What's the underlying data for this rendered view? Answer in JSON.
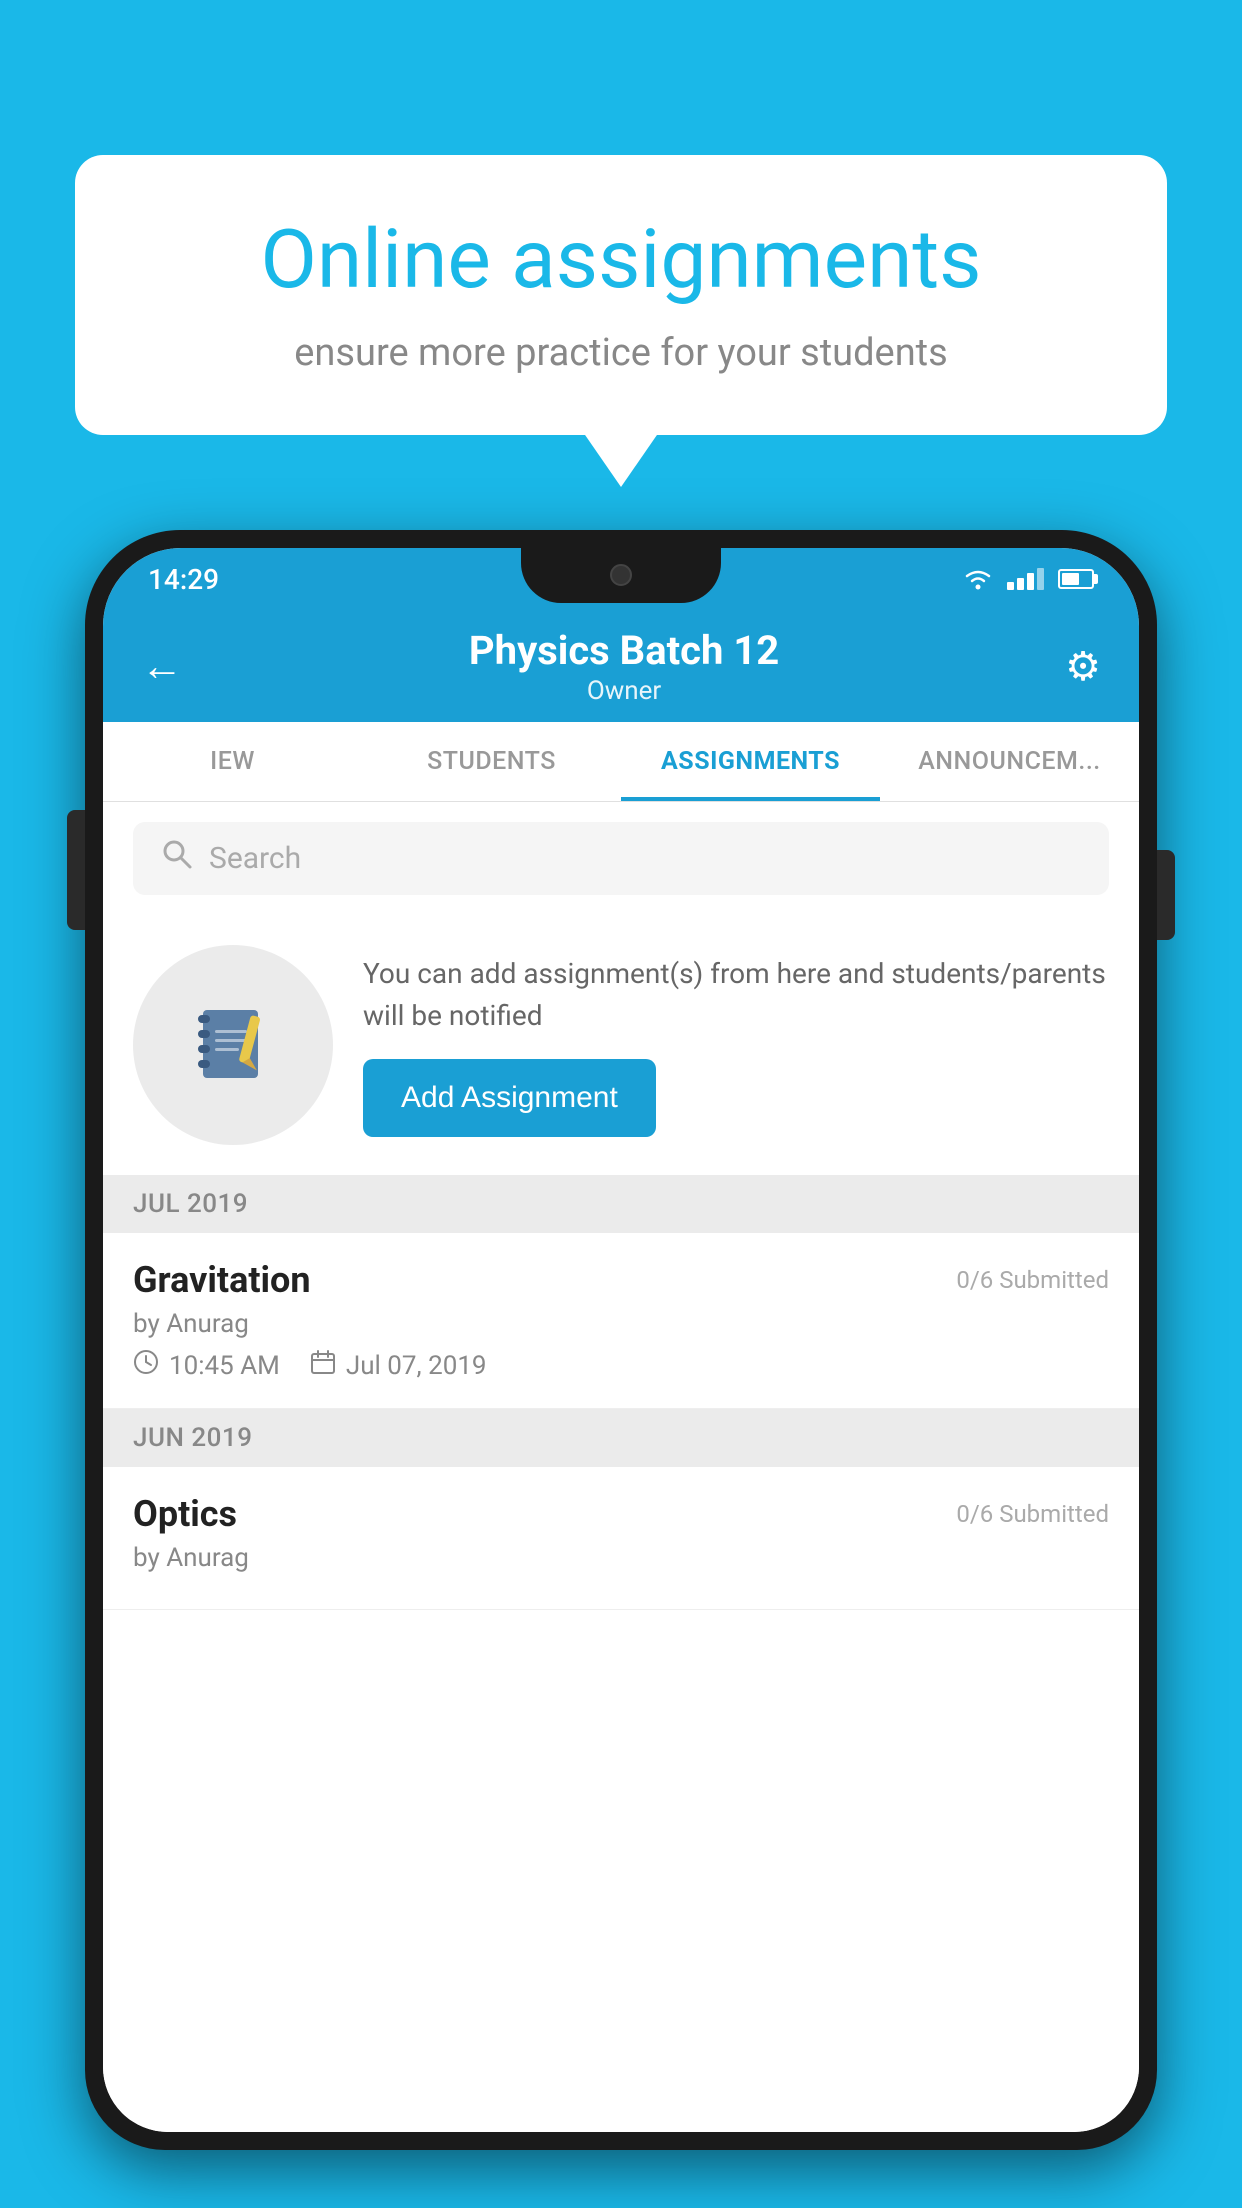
{
  "background_color": "#1ab8e8",
  "speech_bubble": {
    "title": "Online assignments",
    "subtitle": "ensure more practice for your students"
  },
  "status_bar": {
    "time": "14:29",
    "wifi": true,
    "signal": true,
    "battery": true
  },
  "header": {
    "title": "Physics Batch 12",
    "subtitle": "Owner",
    "back_label": "←",
    "settings_label": "⚙"
  },
  "tabs": [
    {
      "label": "IEW",
      "active": false
    },
    {
      "label": "STUDENTS",
      "active": false
    },
    {
      "label": "ASSIGNMENTS",
      "active": true
    },
    {
      "label": "ANNOUNCEM...",
      "active": false
    }
  ],
  "search": {
    "placeholder": "Search"
  },
  "promo": {
    "text": "You can add assignment(s) from here and students/parents will be notified",
    "button_label": "Add Assignment"
  },
  "sections": [
    {
      "label": "JUL 2019",
      "assignments": [
        {
          "title": "Gravitation",
          "submitted": "0/6 Submitted",
          "by": "by Anurag",
          "time": "10:45 AM",
          "date": "Jul 07, 2019"
        }
      ]
    },
    {
      "label": "JUN 2019",
      "assignments": [
        {
          "title": "Optics",
          "submitted": "0/6 Submitted",
          "by": "by Anurag",
          "time": "",
          "date": ""
        }
      ]
    }
  ]
}
